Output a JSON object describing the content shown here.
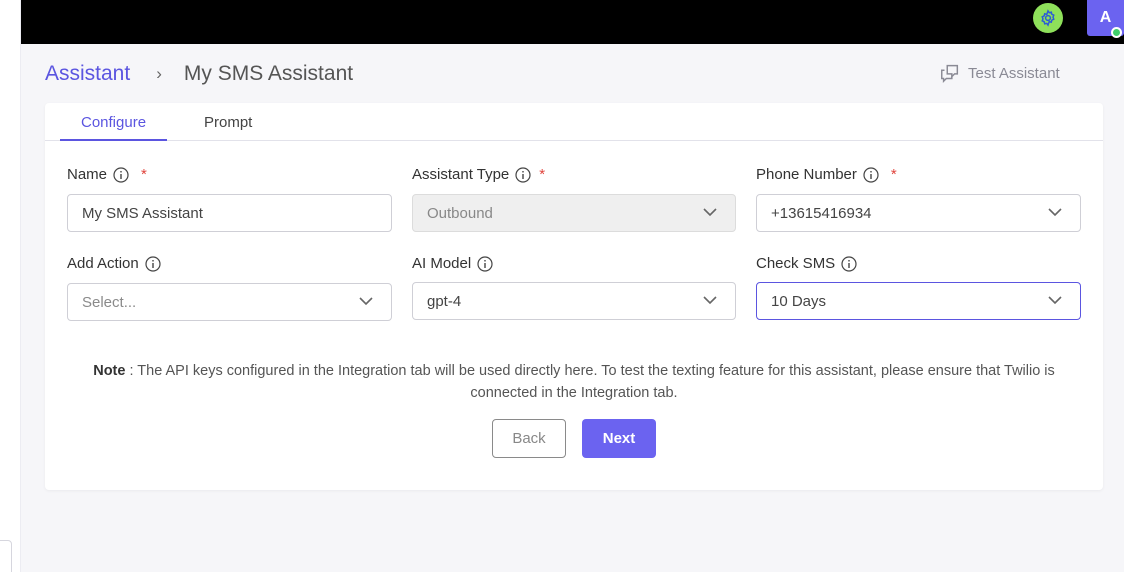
{
  "topbar": {
    "avatar_initial": "A",
    "gear_color": "#8ee05a",
    "avatar_color": "#6b63f0"
  },
  "breadcrumb": {
    "root": "Assistant",
    "separator": "›",
    "current": "My SMS Assistant"
  },
  "header": {
    "test_button_label": "Test Assistant"
  },
  "tabs": [
    {
      "label": "Configure",
      "active": true
    },
    {
      "label": "Prompt",
      "active": false
    }
  ],
  "form": {
    "name": {
      "label": "Name",
      "value": "My SMS Assistant",
      "required": "*"
    },
    "assistant_type": {
      "label": "Assistant Type",
      "value": "Outbound",
      "required": "*"
    },
    "phone_number": {
      "label": "Phone Number",
      "value": "+13615416934",
      "required": "*"
    },
    "add_action": {
      "label": "Add Action",
      "placeholder": "Select..."
    },
    "ai_model": {
      "label": "AI Model",
      "value": "gpt-4"
    },
    "check_sms": {
      "label": "Check SMS",
      "value": "10 Days"
    }
  },
  "note": {
    "prefix": "Note",
    "text": " : The API keys configured in the Integration tab will be used directly here. To test the texting feature for this assistant, please ensure that Twilio is connected in the Integration tab."
  },
  "actions": {
    "back_label": "Back",
    "next_label": "Next"
  },
  "colors": {
    "accent": "#5b55e0",
    "required": "#e0443c"
  }
}
